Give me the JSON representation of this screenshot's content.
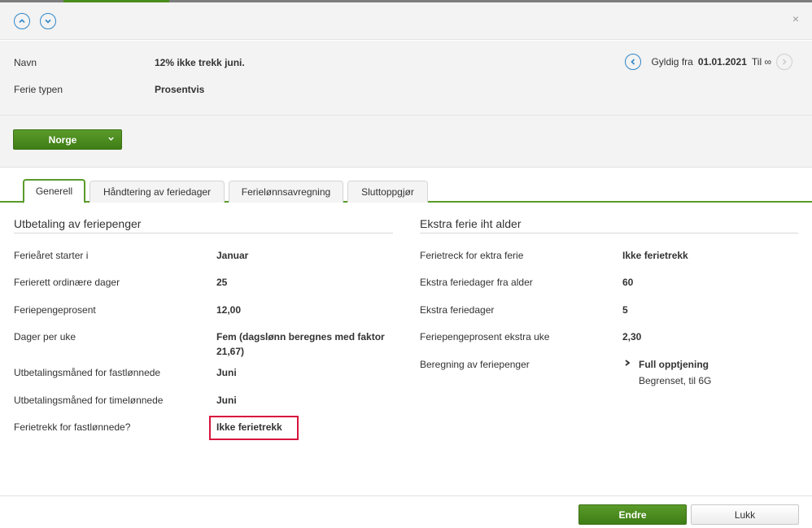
{
  "header": {
    "up_icon": "chevron-up-icon",
    "down_icon": "chevron-down-icon",
    "close_symbol": "×"
  },
  "info": {
    "name_label": "Navn",
    "name_value": "12% ikke trekk juni.",
    "type_label": "Ferie typen",
    "type_value": "Prosentvis",
    "valid_prefix": "Gyldig fra",
    "valid_date": "01.01.2021",
    "valid_til": "Til ∞"
  },
  "country": {
    "label": "Norge"
  },
  "tabs": [
    {
      "label": "Generell",
      "active": true
    },
    {
      "label": "Håndtering av feriedager",
      "active": false
    },
    {
      "label": "Ferielønnsavregning",
      "active": false
    },
    {
      "label": "Sluttoppgjør",
      "active": false
    }
  ],
  "left_section": {
    "title": "Utbetaling av feriepenger",
    "rows": [
      {
        "label": "Ferieåret starter i",
        "value": "Januar"
      },
      {
        "label": "Ferierett ordinære dager",
        "value": "25"
      },
      {
        "label": "Feriepengeprosent",
        "value": "12,00"
      },
      {
        "label": "Dager per uke",
        "value": "Fem (dagslønn beregnes med faktor",
        "value2": "21,67)"
      },
      {
        "label": "Utbetalingsmåned for fastlønnede",
        "value": "Juni"
      },
      {
        "label": "Utbetalingsmåned for timelønnede",
        "value": "Juni"
      },
      {
        "label": "Ferietrekk for fastlønnede?",
        "value": "Ikke ferietrekk"
      }
    ]
  },
  "right_section": {
    "title": "Ekstra ferie iht alder",
    "rows": [
      {
        "label": "Ferietreck for ektra ferie",
        "value": "Ikke ferietrekk"
      },
      {
        "label": "Ekstra feriedager fra alder",
        "value": "60"
      },
      {
        "label": "Ekstra feriedager",
        "value": "5"
      },
      {
        "label": "Feriepengeprosent ekstra uke",
        "value": "2,30"
      },
      {
        "label": "Beregning av feriepenger",
        "value": "Full opptjening",
        "value2": "Begrenset, til 6G"
      }
    ]
  },
  "footer": {
    "primary_label": "Endre",
    "secondary_label": "Lukk"
  },
  "colors": {
    "accent_green": "#4a8c1c",
    "link_blue": "#2f86c9",
    "highlight_red": "#d6153e"
  }
}
